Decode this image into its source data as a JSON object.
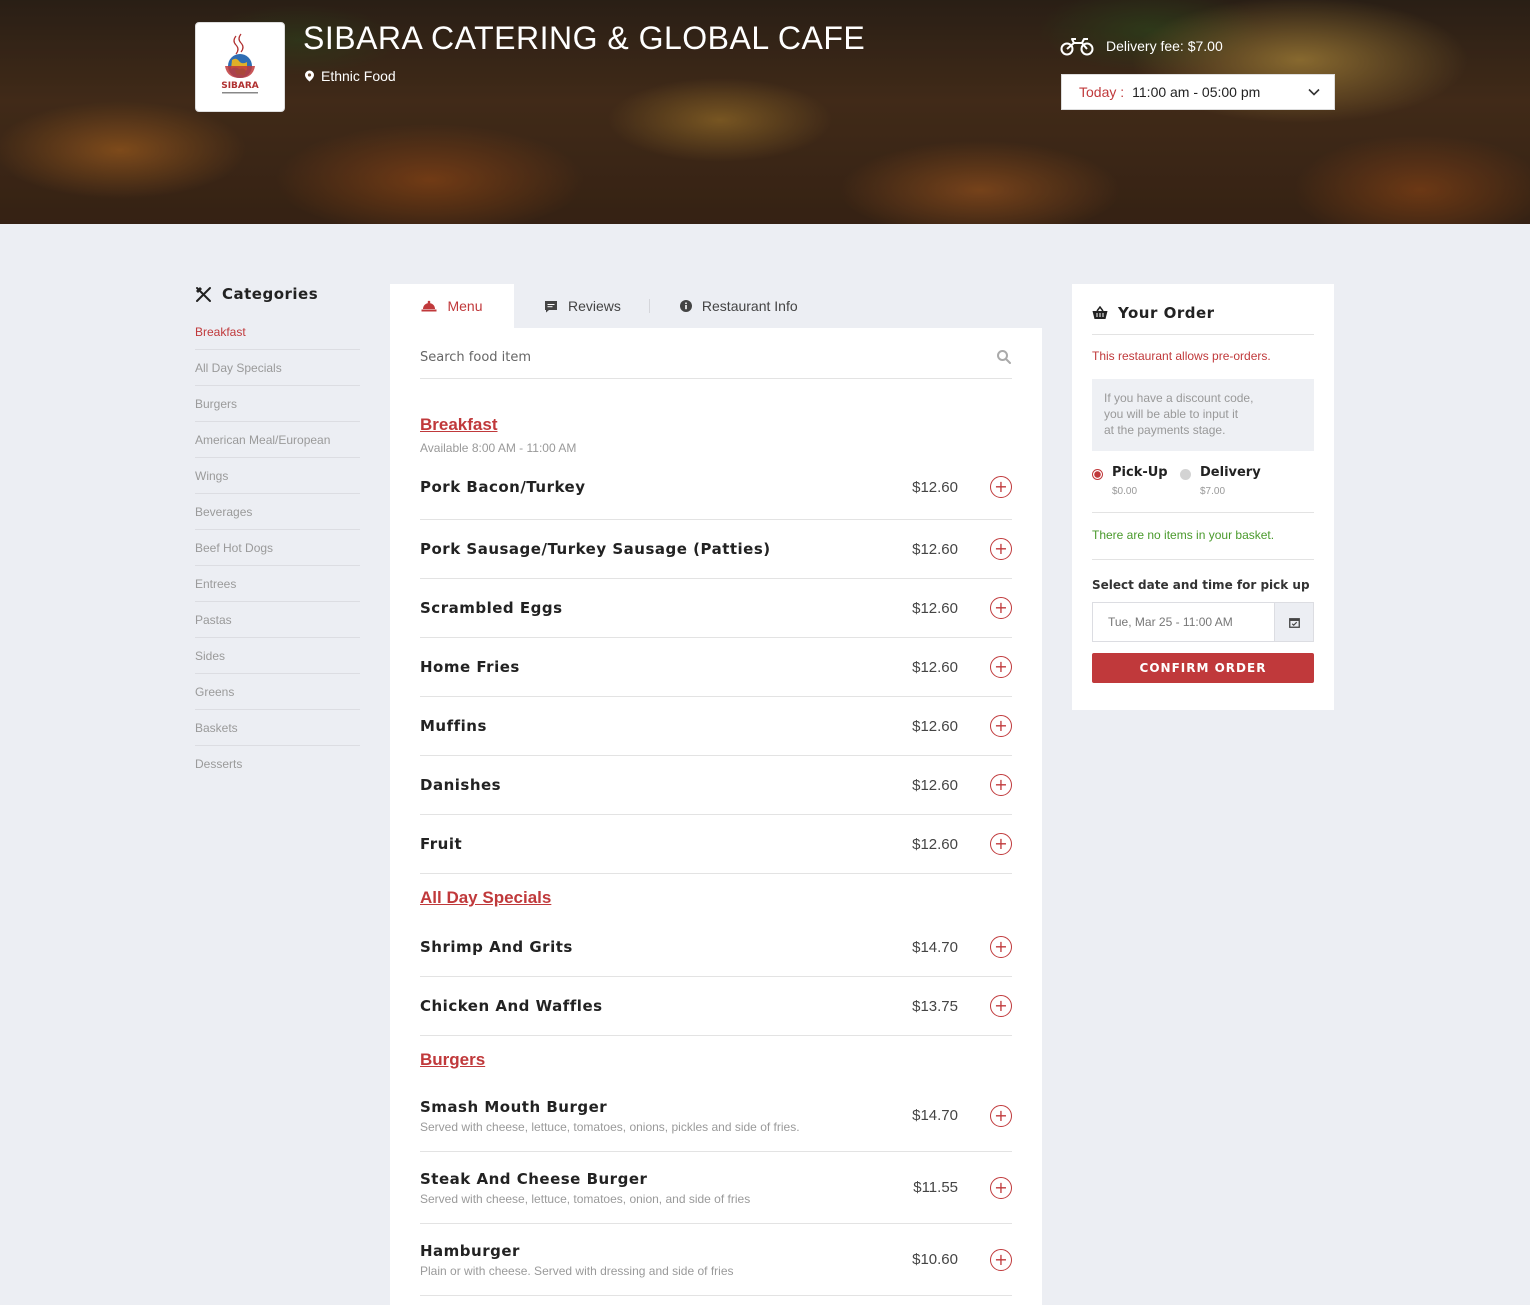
{
  "header": {
    "restaurant_name": "SIBARA CATERING & GLOBAL CAFE",
    "logo_text": "SIBARA",
    "cuisine": "Ethnic Food",
    "delivery_fee": "Delivery fee: $7.00",
    "hours": {
      "today_label": "Today :",
      "range": "11:00 am - 05:00 pm"
    }
  },
  "sidebar": {
    "title": "Categories",
    "items": [
      {
        "label": "Breakfast",
        "active": true
      },
      {
        "label": "All Day Specials"
      },
      {
        "label": "Burgers"
      },
      {
        "label": "American Meal/European"
      },
      {
        "label": "Wings"
      },
      {
        "label": "Beverages"
      },
      {
        "label": "Beef Hot Dogs"
      },
      {
        "label": "Entrees"
      },
      {
        "label": "Pastas"
      },
      {
        "label": "Sides"
      },
      {
        "label": "Greens"
      },
      {
        "label": "Baskets"
      },
      {
        "label": "Desserts"
      }
    ]
  },
  "tabs": [
    {
      "label": "Menu",
      "active": true
    },
    {
      "label": "Reviews"
    },
    {
      "label": "Restaurant Info"
    }
  ],
  "search": {
    "placeholder": "Search food item"
  },
  "menu": {
    "sections": [
      {
        "title": "Breakfast",
        "subtitle": "Available 8:00 AM - 11:00 AM",
        "items": [
          {
            "name": "Pork Bacon/Turkey",
            "price": "$12.60"
          },
          {
            "name": "Pork Sausage/Turkey Sausage (Patties)",
            "price": "$12.60"
          },
          {
            "name": "Scrambled Eggs",
            "price": "$12.60"
          },
          {
            "name": "Home Fries",
            "price": "$12.60"
          },
          {
            "name": "Muffins",
            "price": "$12.60"
          },
          {
            "name": "Danishes",
            "price": "$12.60"
          },
          {
            "name": "Fruit",
            "price": "$12.60"
          }
        ]
      },
      {
        "title": "All Day Specials",
        "items": [
          {
            "name": "Shrimp And Grits",
            "price": "$14.70"
          },
          {
            "name": "Chicken And Waffles",
            "price": "$13.75"
          }
        ]
      },
      {
        "title": "Burgers",
        "items": [
          {
            "name": "Smash Mouth Burger",
            "price": "$14.70",
            "description": "Served with cheese, lettuce, tomatoes, onions, pickles and side of fries."
          },
          {
            "name": "Steak And Cheese Burger",
            "price": "$11.55",
            "description": "Served with cheese, lettuce, tomatoes, onion, and side of fries"
          },
          {
            "name": "Hamburger",
            "price": "$10.60",
            "description": "Plain or with cheese. Served with dressing and side of fries"
          }
        ]
      }
    ],
    "add_symbol": "+"
  },
  "order": {
    "title": "Your Order",
    "preorder_note": "This restaurant allows pre-orders.",
    "discount_lines": [
      "If you have a discount code,",
      "you will be able to input it",
      "at the payments stage."
    ],
    "modes": [
      {
        "label": "Pick-Up",
        "fee": "$0.00",
        "selected": true
      },
      {
        "label": "Delivery",
        "fee": "$7.00",
        "selected": false
      }
    ],
    "empty_basket": "There are no items in your basket.",
    "pick_label": "Select date and time for pick up",
    "datetime_value": "Tue, Mar 25 - 11:00 AM",
    "confirm_label": "CONFIRM ORDER"
  },
  "colors": {
    "accent": "#c0393b",
    "success": "#4a9a2c",
    "page_bg": "#eceef3"
  },
  "icons": [
    "map-pin-icon",
    "motorcycle-icon",
    "chevron-down-icon",
    "utensils-icon",
    "menu-bell-icon",
    "chat-icon",
    "info-icon",
    "search-icon",
    "plus-circle-icon",
    "basket-icon",
    "calendar-icon"
  ]
}
